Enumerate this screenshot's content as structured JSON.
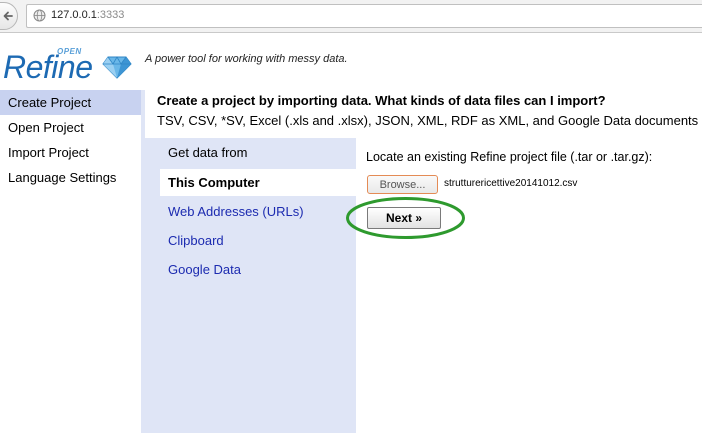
{
  "browser": {
    "url_host": "127.0.0.1",
    "url_port": ":3333"
  },
  "header": {
    "logo_small": "OPEN",
    "logo_text": "Refine",
    "tagline": "A power tool for working with messy data."
  },
  "nav": {
    "items": [
      {
        "label": "Create Project"
      },
      {
        "label": "Open Project"
      },
      {
        "label": "Import Project"
      },
      {
        "label": "Language Settings"
      }
    ]
  },
  "main": {
    "heading": "Create a project by importing data. What kinds of data files can I import?",
    "subheading": "TSV, CSV, *SV, Excel (.xls and .xlsx), JSON, XML, RDF as XML, and Google Data documents"
  },
  "sources": {
    "label": "Get data from",
    "items": [
      {
        "label": "This Computer"
      },
      {
        "label": "Web Addresses (URLs)"
      },
      {
        "label": "Clipboard"
      },
      {
        "label": "Google Data"
      }
    ]
  },
  "import_form": {
    "locate_label": "Locate an existing Refine project file (.tar or .tar.gz):",
    "browse_label": "Browse...",
    "filename": "strutturericettive20141012.csv",
    "next_label": "Next »"
  },
  "colors": {
    "accent_blue": "#1d6ab3",
    "nav_selected": "#c8d2f0",
    "panel_bg": "#dfe5f6",
    "link": "#1c2bb0",
    "highlight_ring": "#2e9a2e"
  }
}
